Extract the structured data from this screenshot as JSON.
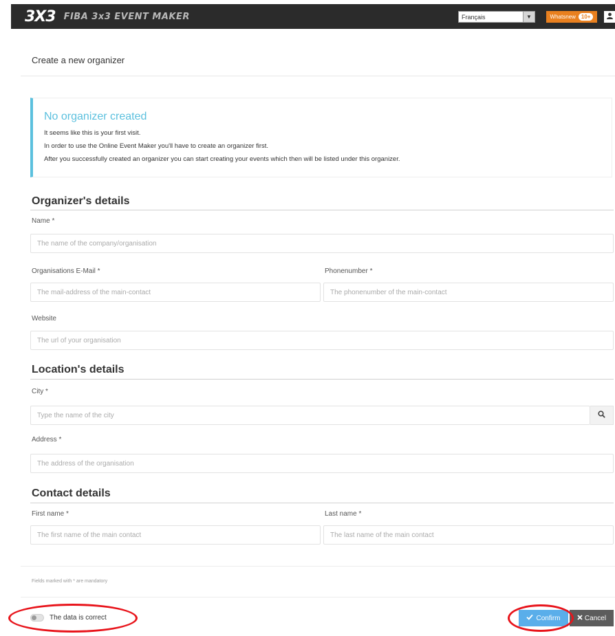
{
  "header": {
    "logo_mark": "3X3",
    "app_title": "FIBA 3x3 EVENT MAKER",
    "language": "Français",
    "notifications": {
      "label": "Whatsnew",
      "count": "10+"
    },
    "user_initial": "V"
  },
  "panel": {
    "title": "Create a new organizer"
  },
  "callout": {
    "title": "No organizer created",
    "lines": [
      "It seems like this is your first visit.",
      "In order to use the Online Event Maker you'll have to create an organizer first.",
      "After you successfully created an organizer you can start creating your events which then will be listed under this organizer."
    ]
  },
  "sections": {
    "organizer": {
      "title": "Organizer's details",
      "name": {
        "label": "Name *",
        "placeholder": "The name of the company/organisation",
        "value": ""
      },
      "email": {
        "label": "Organisations E-Mail *",
        "placeholder": "The mail-address of the main-contact",
        "value": ""
      },
      "phone": {
        "label": "Phonenumber *",
        "placeholder": "The phonenumber of the main-contact",
        "value": ""
      },
      "website": {
        "label": "Website",
        "placeholder": "The url of your organisation",
        "value": ""
      }
    },
    "location": {
      "title": "Location's details",
      "city": {
        "label": "City *",
        "placeholder": "Type the name of the city",
        "value": ""
      },
      "address": {
        "label": "Address *",
        "placeholder": "The address of the organisation",
        "value": ""
      }
    },
    "contact": {
      "title": "Contact details",
      "first_name": {
        "label": "First name *",
        "placeholder": "The first name of the main contact",
        "value": ""
      },
      "last_name": {
        "label": "Last name *",
        "placeholder": "The last name of the main contact",
        "value": ""
      }
    }
  },
  "footer": {
    "mandatory_note": "Fields marked with * are mandatory",
    "toggle_label": "The data is correct",
    "toggle_on": false,
    "confirm_label": "Confirm",
    "cancel_label": "Cancel"
  },
  "colors": {
    "topbar": "#2b2b2b",
    "accent_info": "#5bc0de",
    "confirm": "#5aaeea",
    "cancel": "#5c5c5c",
    "notification": "#e9801f",
    "annotation": "#e8141b"
  },
  "icons": {
    "search": "search-icon",
    "check": "check-icon",
    "cancel": "close-icon",
    "user": "user-icon",
    "caret": "chevron-down-icon"
  }
}
